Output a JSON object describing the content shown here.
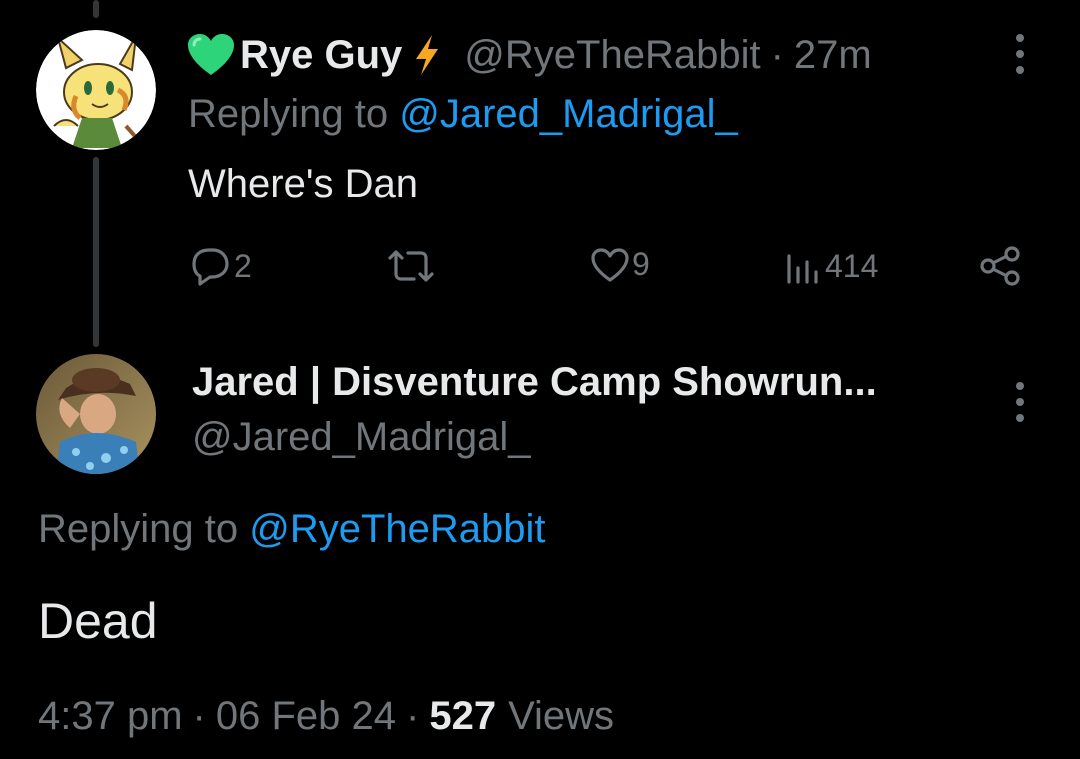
{
  "colors": {
    "background": "#000000",
    "primary_text": "#e7e9ea",
    "secondary_text": "#71767b",
    "link": "#1d9bf0",
    "heart_emoji": "#2ed47a",
    "bolt_emoji": "#f5a623"
  },
  "tweet1": {
    "name": "Rye Guy",
    "name_emoji_prefix": "green-heart-icon",
    "name_emoji_suffix": "lightning-icon",
    "handle": "@RyeTheRabbit",
    "separator": "·",
    "time": "27m",
    "replying_prefix": "Replying to",
    "replying_handle": "@Jared_Madrigal_",
    "text": "Where's Dan",
    "actions": {
      "replies": "2",
      "retweets": "",
      "likes": "9",
      "views": "414"
    }
  },
  "tweet2": {
    "name": "Jared | Disventure Camp Showrun...",
    "handle": "@Jared_Madrigal_",
    "replying_prefix": "Replying to",
    "replying_handle": "@RyeTheRabbit",
    "text": "Dead",
    "time": "4:37 pm",
    "sep1": "·",
    "date": "06 Feb 24",
    "sep2": "·",
    "views_count": "527",
    "views_label": "Views"
  }
}
